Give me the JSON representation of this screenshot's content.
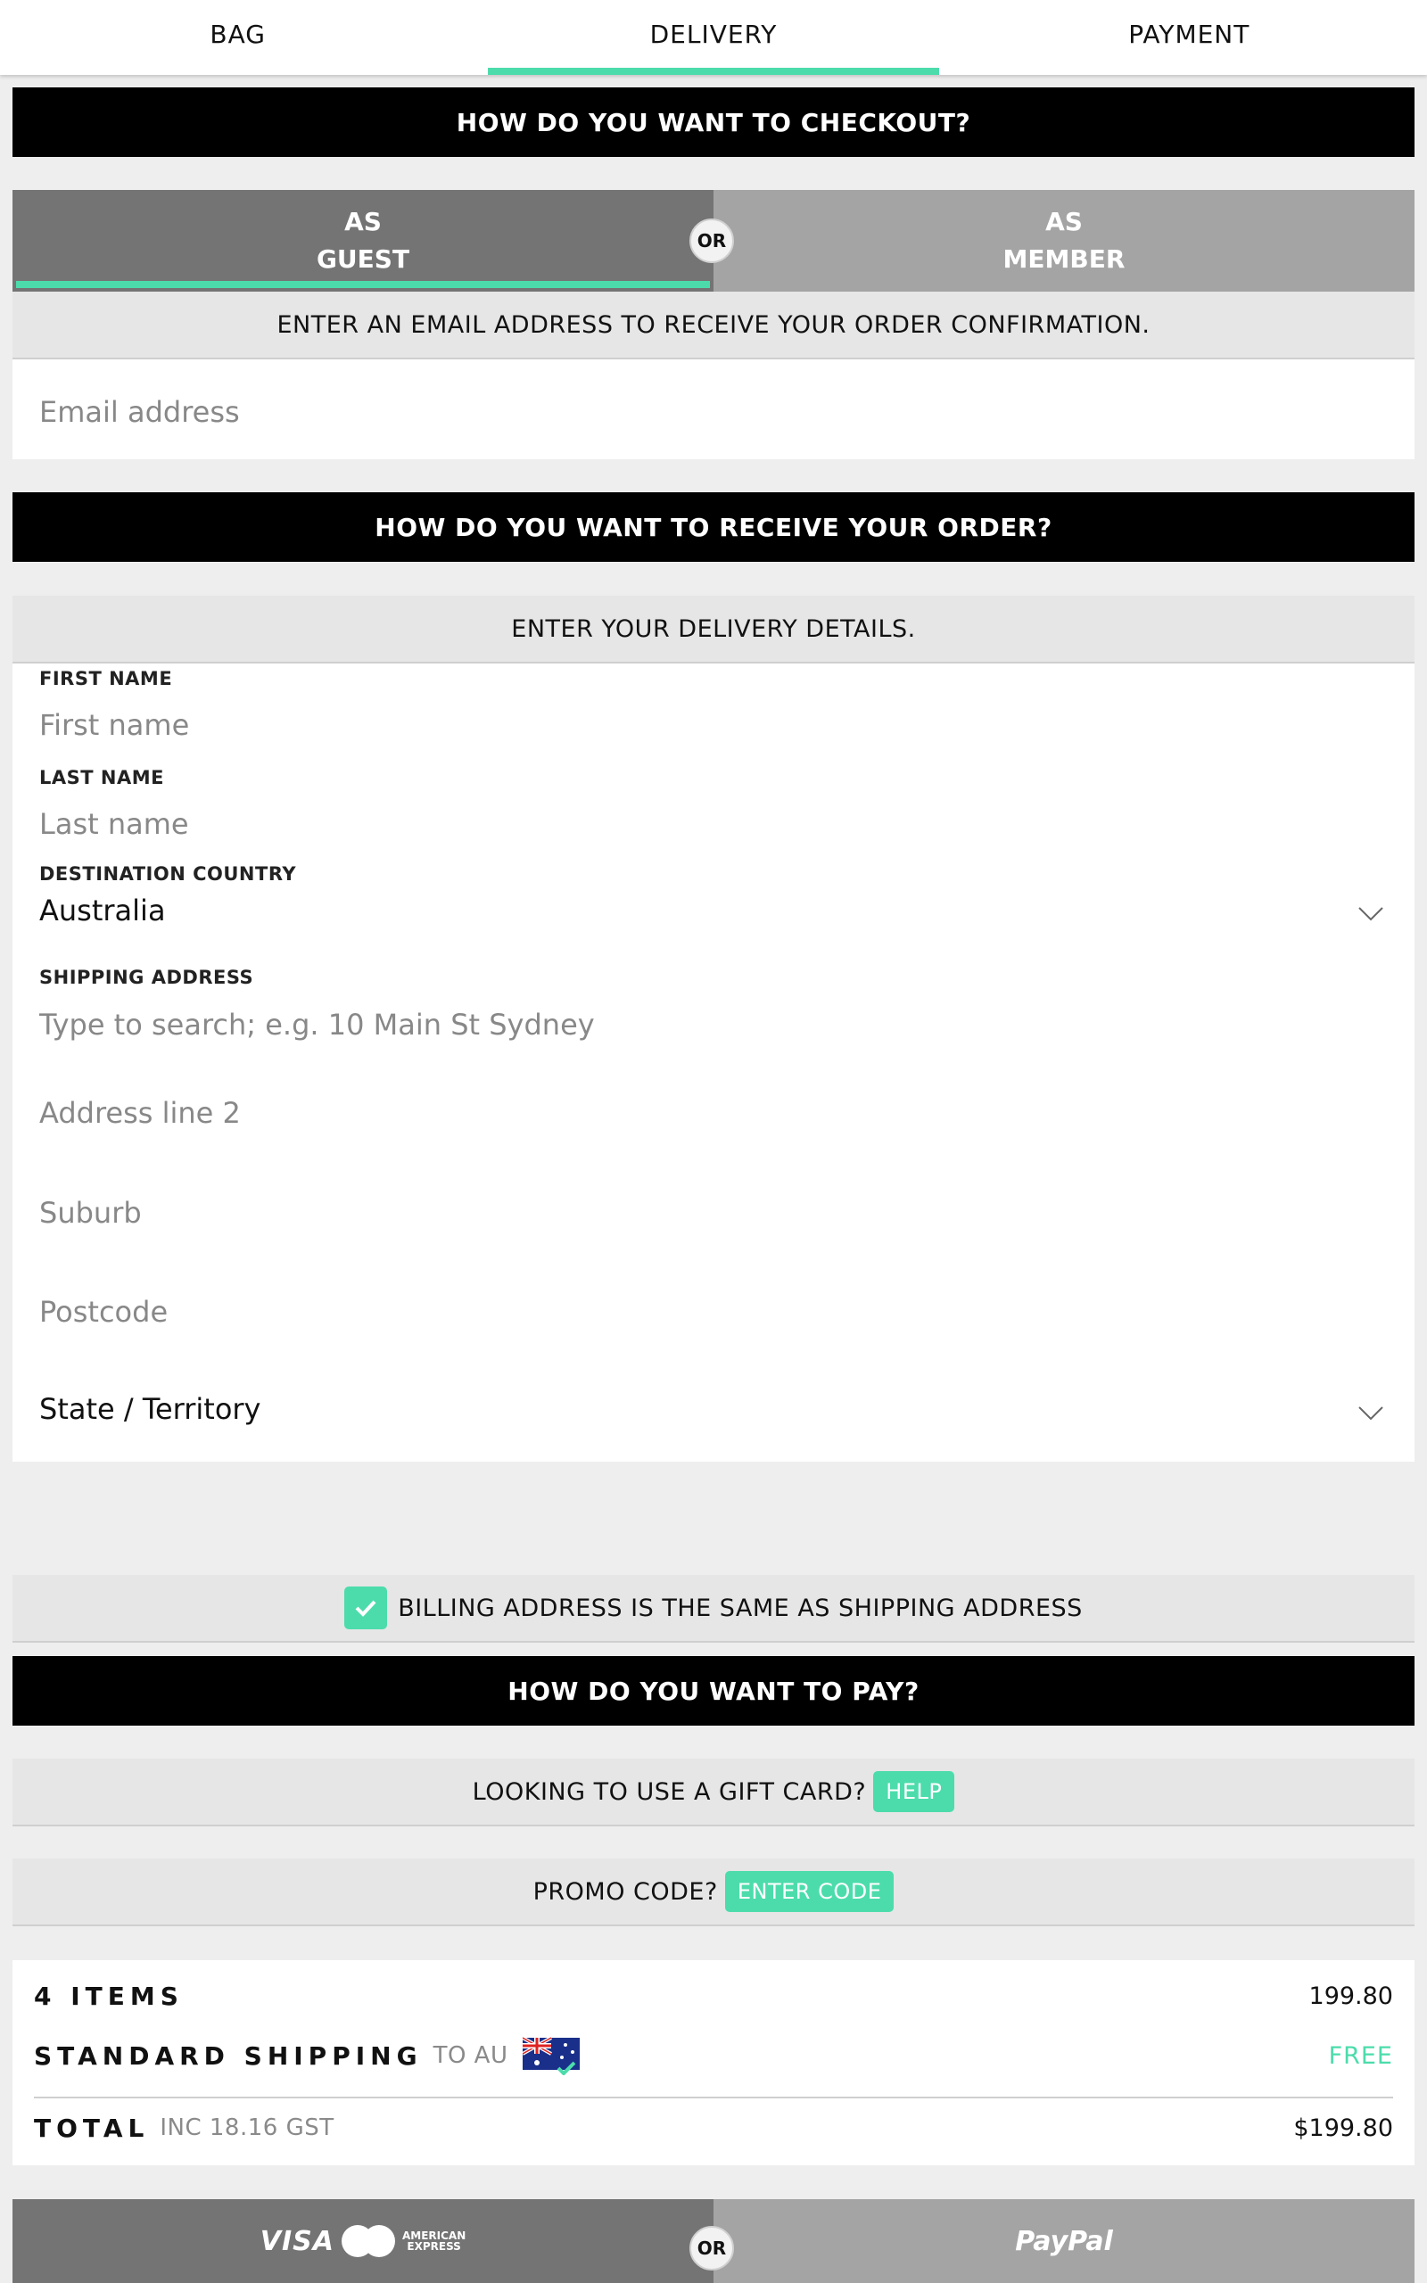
{
  "steps": [
    "BAG",
    "DELIVERY",
    "PAYMENT"
  ],
  "checkout": {
    "heading": "HOW DO YOU WANT TO CHECKOUT?",
    "guest_line1": "AS",
    "guest_line2": "GUEST",
    "member_line1": "AS",
    "member_line2": "MEMBER",
    "or": "OR",
    "email_prompt": "ENTER AN EMAIL ADDRESS TO RECEIVE YOUR ORDER CONFIRMATION.",
    "email_placeholder": "Email address"
  },
  "receive": {
    "heading": "HOW DO YOU WANT TO RECEIVE YOUR ORDER?",
    "prompt": "ENTER YOUR DELIVERY DETAILS."
  },
  "form": {
    "first_name_label": "FIRST NAME",
    "first_name_placeholder": "First name",
    "last_name_label": "LAST NAME",
    "last_name_placeholder": "Last name",
    "country_label": "DESTINATION COUNTRY",
    "country_value": "Australia",
    "shipping_label": "SHIPPING ADDRESS",
    "shipping_placeholder": "Type to search; e.g. 10 Main St Sydney",
    "address2_placeholder": "Address line 2",
    "suburb_placeholder": "Suburb",
    "postcode_placeholder": "Postcode",
    "state_value": "State / Territory"
  },
  "billing": {
    "checked": true,
    "label": "BILLING ADDRESS IS THE SAME AS SHIPPING ADDRESS"
  },
  "pay": {
    "heading": "HOW DO YOU WANT TO PAY?",
    "gift_text": "LOOKING TO USE A GIFT CARD?",
    "gift_help": "HELP",
    "promo_text": "PROMO CODE?",
    "promo_button": "ENTER CODE"
  },
  "summary": {
    "items_label": "4 ITEMS",
    "items_value": "199.80",
    "shipping_label": "STANDARD SHIPPING",
    "shipping_to": "TO AU",
    "shipping_value": "FREE",
    "total_label": "TOTAL",
    "total_tax": "INC 18.16 GST",
    "total_value": "$199.80"
  },
  "payment_methods": {
    "visa": "VISA",
    "mastercard": "MasterCard",
    "amex_line1": "AMERICAN",
    "amex_line2": "EXPRESS",
    "or": "OR",
    "paypal": "PayPal"
  },
  "colors": {
    "accent": "#4cdcab",
    "dark_toggle": "#747474",
    "light_toggle": "#a4a4a4"
  }
}
